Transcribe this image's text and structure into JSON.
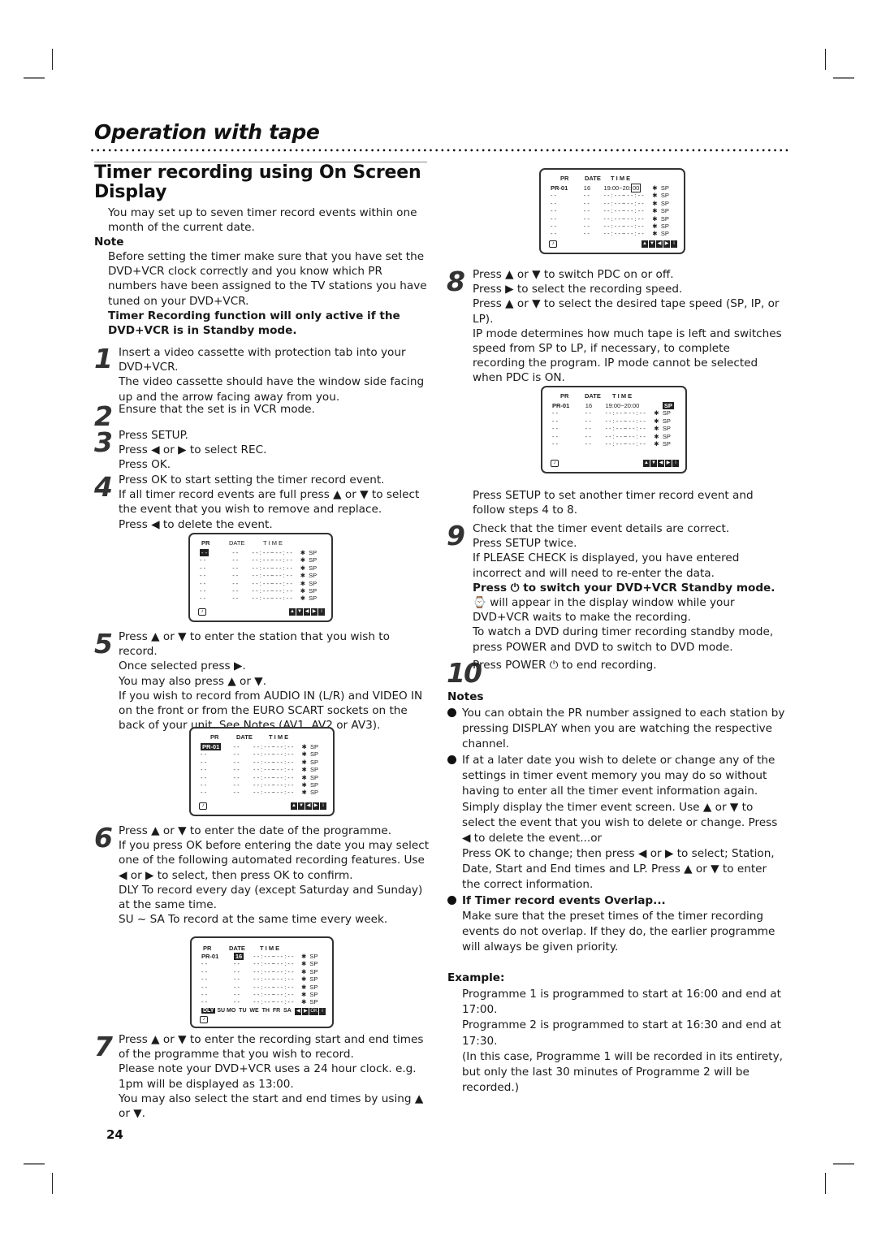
{
  "page": {
    "section_title": "Operation with tape",
    "heading": "Timer recording using On Screen Display",
    "page_number": "24"
  },
  "intro": {
    "text": "You may set up to seven timer record events within one month of the current date.",
    "note_label": "Note",
    "note_text": "Before setting the timer make sure that you have set the DVD+VCR clock correctly and you know which PR numbers have been assigned to the TV stations you have tuned on your DVD+VCR.",
    "note_bold": "Timer Recording function will only active if the DVD+VCR is in Standby mode."
  },
  "steps": [
    {
      "num": "1",
      "lines": [
        "Insert a video cassette with protection tab into your DVD+VCR.",
        "The video cassette should have the window side facing up and the arrow facing away from you."
      ]
    },
    {
      "num": "2",
      "lines": [
        "Ensure that the set is in VCR mode."
      ]
    },
    {
      "num": "3",
      "lines": [
        "Press SETUP.",
        "Press ◀ or ▶ to select REC.",
        "Press OK."
      ]
    },
    {
      "num": "4",
      "lines": [
        "Press OK to start setting the timer record event.",
        "If all timer record events are full press ▲ or ▼ to select the event that you wish to remove and replace.",
        "Press ◀ to delete the event."
      ]
    },
    {
      "num": "5",
      "lines": [
        "Press ▲ or ▼ to enter the station that you wish to record.",
        "Once selected press ▶.",
        "You may also press ▲ or ▼.",
        "If you wish to record from AUDIO IN (L/R) and VIDEO IN on the front or from the EURO SCART sockets on the back of your unit, See Notes (AV1, AV2 or AV3)."
      ]
    },
    {
      "num": "6",
      "lines": [
        "Press ▲ or ▼ to enter the date of the programme.",
        "If you press OK before entering the date you may select one of the following automated recording features. Use ◀ or ▶ to select, then press OK to confirm.",
        "DLY To record every day (except Saturday and Sunday) at the same time.",
        "SU ~ SA To record at the same time every week."
      ]
    },
    {
      "num": "7",
      "lines": [
        "Press ▲ or ▼ to enter the recording start and end times of the programme that you wish to record.",
        "Please note your DVD+VCR uses a 24 hour clock. e.g. 1pm will be displayed as 13:00.",
        "You may also select the start and end times by using ▲ or ▼."
      ]
    },
    {
      "num": "8",
      "lines": [
        "Press ▲ or ▼ to switch PDC on or off.",
        "Press ▶ to select the recording speed.",
        "Press ▲ or ▼ to select the desired tape speed (SP, IP, or LP).",
        "IP mode determines how much tape is left and switches speed from SP to LP, if necessary, to complete recording the program. IP mode cannot be selected when PDC is ON.",
        "Press SETUP to set another timer record event and follow steps 4 to 8."
      ]
    },
    {
      "num": "9",
      "lines": [
        "Check that the timer event details are correct.",
        "Press SETUP twice.",
        "If PLEASE CHECK is displayed, you have entered incorrect and will need to re-enter the data.",
        "Press ⏻ to switch your DVD+VCR Standby mode.",
        "⌚ will appear in the display window while your DVD+VCR waits to make the recording.",
        "To watch a DVD during timer recording standby mode, press POWER and DVD to switch to DVD mode."
      ]
    },
    {
      "num": "10",
      "lines": [
        "Press POWER ⏻ to end recording."
      ]
    }
  ],
  "osd": {
    "headers": {
      "pr": "PR",
      "date": "DATE",
      "time": "T I M E"
    },
    "empty_pr": "- -",
    "empty_date": "- -",
    "empty_time": "- - : - - ~ - - : - -",
    "pdc_mark": "✱",
    "speed": "SP",
    "clock_icon": "⌚",
    "keys": [
      "▲",
      "▼",
      "◀",
      "▶",
      "i"
    ],
    "keys_ok": [
      "◀",
      "▶",
      "OK",
      "i"
    ],
    "selected_pr": "PR-01",
    "selected_date": "16",
    "time_filled": "19:00~20:",
    "time_minutes": "00",
    "time_full": "19:00~20:00",
    "days": [
      "DLY",
      "SU",
      "MO",
      "TU",
      "WE",
      "TH",
      "FR",
      "SA"
    ]
  },
  "notes": {
    "label": "Notes",
    "items": [
      "You can obtain the PR number assigned to each station by pressing  DISPLAY when you are watching the respective channel.",
      "If at a later date you wish to delete or change any of the settings in timer event memory you may do so without having to enter all the timer event information again. Simply display the timer event screen. Use ▲ or ▼ to select the event that you wish to delete or change. Press ◀ to delete the event...or",
      "Press OK to change; then press ◀ or ▶ to select; Station, Date, Start and End times and LP. Press ▲ or ▼ to enter the correct information."
    ],
    "overlap_title": "If Timer record events Overlap...",
    "overlap_text": "Make sure that the preset times of the timer recording events do not overlap. If they do, the earlier programme will always be given priority."
  },
  "example": {
    "label": "Example:",
    "lines": [
      "Programme 1 is programmed to start at 16:00 and end at 17:00.",
      "Programme 2 is programmed to start at 16:30 and end at 17:30.",
      "(In this case, Programme 1 will be recorded in its entirety, but only the last 30 minutes of Programme 2 will be recorded.)"
    ]
  }
}
